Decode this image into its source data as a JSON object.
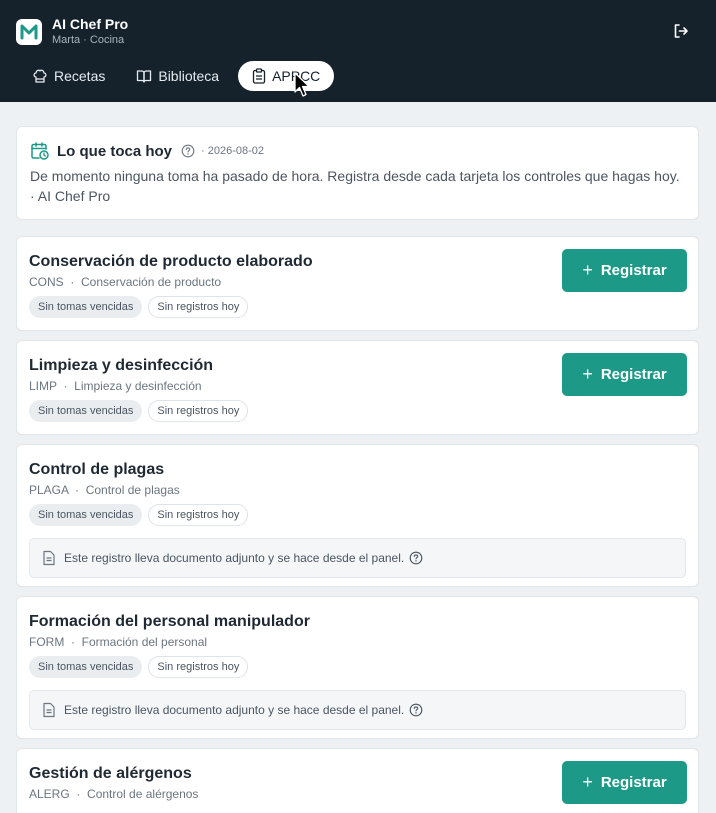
{
  "header": {
    "app_title": "AI Chef Pro",
    "subtitle": "Marta · Cocina",
    "logo_letter": "M"
  },
  "tabs": [
    {
      "label": "Recetas",
      "icon": "chef-hat-icon",
      "active": false
    },
    {
      "label": "Biblioteca",
      "icon": "book-icon",
      "active": false
    },
    {
      "label": "APPCC",
      "icon": "clipboard-icon",
      "active": true
    }
  ],
  "today": {
    "title": "Lo que toca hoy",
    "date": "· 2026-08-02",
    "message": "De momento ninguna toma ha pasado de hora. Registra desde cada tarjeta los controles que hagas hoy. · AI Chef Pro"
  },
  "register_label": "Registrar",
  "items": [
    {
      "title": "Conservación de producto elaborado",
      "code": "CONS",
      "category": "Conservación de producto",
      "chip1": "Sin tomas vencidas",
      "chip2": "Sin registros hoy"
    },
    {
      "title": "Limpieza y desinfección",
      "code": "LIMP",
      "category": "Limpieza y desinfección",
      "chip1": "Sin tomas vencidas",
      "chip2": "Sin registros hoy"
    },
    {
      "title": "Control de plagas",
      "code": "PLAGA",
      "category": "Control de plagas",
      "chip1": "Sin tomas vencidas",
      "chip2": "Sin registros hoy",
      "notice": "Este registro lleva documento adjunto y se hace desde el panel."
    },
    {
      "title": "Formación del personal manipulador",
      "code": "FORM",
      "category": "Formación del personal",
      "chip1": "Sin tomas vencidas",
      "chip2": "Sin registros hoy",
      "notice": "Este registro lleva documento adjunto y se hace desde el panel."
    },
    {
      "title": "Gestión de alérgenos",
      "code": "ALERG",
      "category": "Control de alérgenos"
    }
  ],
  "colors": {
    "header": "#15212b",
    "accent": "#1c9a87"
  }
}
